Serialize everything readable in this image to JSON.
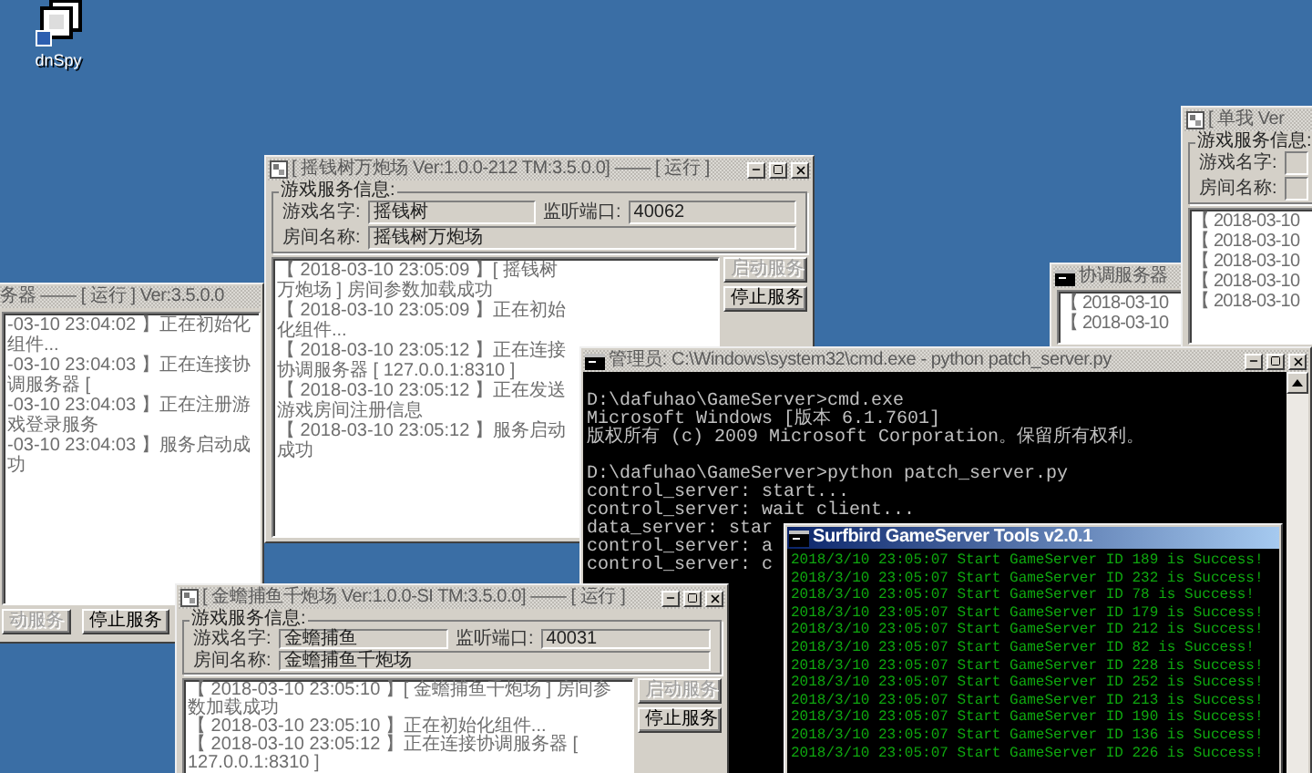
{
  "desktop_icons": [
    {
      "label": "dnSpy"
    }
  ],
  "left_server_window": {
    "title": "务器 —— [ 运行 ] Ver:3.5.0.0",
    "active": false,
    "log": [
      "-03-10 23:04:02 】正在初始化组件...",
      "-03-10 23:04:03 】正在连接协调服务器 [",
      "-03-10 23:04:03 】正在注册游戏登录服务",
      "-03-10 23:04:03 】服务启动成功"
    ],
    "buttons": [
      {
        "label": "动服务",
        "disabled": true
      },
      {
        "label": "停止服务",
        "disabled": false
      }
    ]
  },
  "main_server_window": {
    "title": "[ 摇钱树万炮场 Ver:1.0.0-212 TM:3.5.0.0] —— [ 运行 ]",
    "active": false,
    "group_label": "游戏服务信息:",
    "fields": [
      {
        "label": "游戏名字:",
        "value": "摇钱树"
      },
      {
        "label": "监听端口:",
        "value": "40062"
      },
      {
        "label": "房间名称:",
        "value": "摇钱树万炮场"
      }
    ],
    "log": [
      "【 2018-03-10 23:05:09 】[ 摇钱树万炮场 ] 房间参数加载成功",
      "【 2018-03-10 23:05:09 】正在初始化组件...",
      "【 2018-03-10 23:05:12 】正在连接协调服务器 [ 127.0.0.1:8310 ]",
      "【 2018-03-10 23:05:12 】正在发送游戏房间注册信息",
      "【 2018-03-10 23:05:12 】服务启动成功"
    ],
    "buttons": [
      {
        "label": "启动服务",
        "disabled": true
      },
      {
        "label": "停止服务",
        "disabled": false
      }
    ]
  },
  "coordinator_window": {
    "title": "协调服务器",
    "active": false,
    "log": [
      "【 2018-03-10",
      "【 2018-03-10"
    ]
  },
  "right_server_window": {
    "title": "[ 单我 Ver",
    "active": false,
    "group_label": "游戏服务信息:",
    "fields": [
      {
        "label": "游戏名字:"
      },
      {
        "label": "房间名称:"
      }
    ],
    "log": [
      "【 2018-03-10",
      "【 2018-03-10",
      "【 2018-03-10",
      "【 2018-03-10",
      "【 2018-03-10"
    ]
  },
  "cmd_window": {
    "title": "管理员: C:\\Windows\\system32\\cmd.exe - python  patch_server.py",
    "active": false,
    "blocks": [
      [
        "D:\\dafuhao\\GameServer>cmd.exe",
        "Microsoft Windows [版本 6.1.7601]",
        "版权所有 (c) 2009 Microsoft Corporation。保留所有权利。"
      ],
      [
        "D:\\dafuhao\\GameServer>python patch_server.py",
        "control_server: start...",
        "control_server: wait client...",
        "data_server: star",
        "control_server: a",
        "control_server: c"
      ]
    ]
  },
  "fishing_server_window": {
    "title": "[ 金蟾捕鱼千炮场 Ver:1.0.0-SI TM:3.5.0.0] —— [ 运行 ]",
    "active": false,
    "group_label": "游戏服务信息:",
    "fields": [
      {
        "label": "游戏名字:",
        "value": "金蟾捕鱼"
      },
      {
        "label": "监听端口:",
        "value": "40031"
      },
      {
        "label": "房间名称:",
        "value": "金蟾捕鱼千炮场"
      }
    ],
    "log": [
      "【 2018-03-10 23:05:10 】[ 金蟾捕鱼千炮场 ] 房间参数加载成功",
      "【 2018-03-10 23:05:10 】正在初始化组件...",
      "【 2018-03-10 23:05:12 】正在连接协调服务器 [ 127.0.0.1:8310 ]"
    ],
    "buttons": [
      {
        "label": "启动服务",
        "disabled": true
      },
      {
        "label": "停止服务",
        "disabled": false
      }
    ]
  },
  "tools_window": {
    "title": "Surfbird GameServer Tools v2.0.1",
    "active": true,
    "log": [
      "2018/3/10 23:05:07 Start GameServer ID 189 is Success!",
      "2018/3/10 23:05:07 Start GameServer ID 232 is Success!",
      "2018/3/10 23:05:07 Start GameServer ID 78 is Success!",
      "2018/3/10 23:05:07 Start GameServer ID 179 is Success!",
      "2018/3/10 23:05:07 Start GameServer ID 212 is Success!",
      "2018/3/10 23:05:07 Start GameServer ID 82 is Success!",
      "2018/3/10 23:05:07 Start GameServer ID 228 is Success!",
      "2018/3/10 23:05:07 Start GameServer ID 252 is Success!",
      "2018/3/10 23:05:07 Start GameServer ID 213 is Success!",
      "2018/3/10 23:05:07 Start GameServer ID 190 is Success!",
      "2018/3/10 23:05:07 Start GameServer ID 136 is Success!",
      "2018/3/10 23:05:07 Start GameServer ID 226 is Success!"
    ]
  }
}
